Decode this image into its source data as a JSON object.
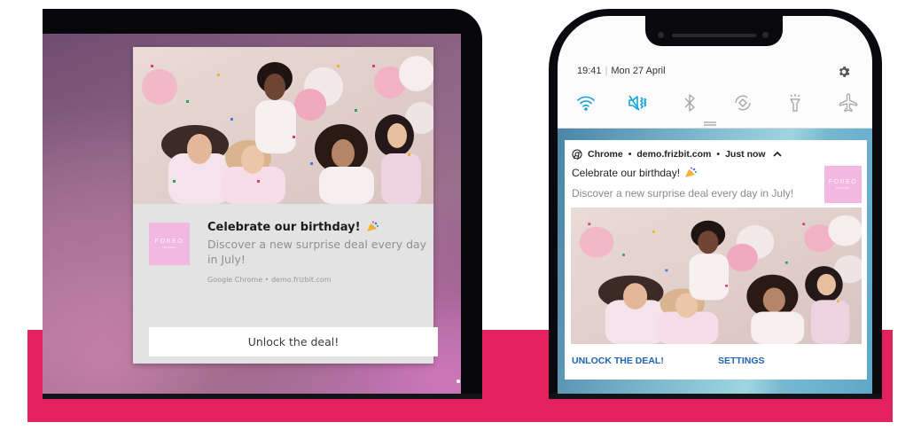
{
  "colors": {
    "band": "#e2215e",
    "brand_tile": "#f2b8e1",
    "mobile_action": "#1e63b5",
    "quick_setting_active": "#1aa3d9",
    "quick_setting_inactive": "#a8a8a8"
  },
  "desktop_notification": {
    "image_alt": "Group of friends celebrating with confetti and pink balloons",
    "logo_text": "FOREO",
    "logo_subtext": "SWEDEN",
    "title": "Celebrate our birthday!",
    "title_emoji": "party-popper-icon",
    "body": "Discover a new surprise deal every day in July!",
    "source": "Google Chrome • demo.frizbit.com",
    "action_label": "Unlock the deal!"
  },
  "phone": {
    "status": {
      "time": "19:41",
      "separator": "|",
      "date": "Mon 27 April",
      "settings_icon": "gear-icon"
    },
    "quick_settings": [
      {
        "name": "wifi",
        "icon": "wifi-icon",
        "active": true
      },
      {
        "name": "sound",
        "icon": "vibrate-mute-icon",
        "active": true
      },
      {
        "name": "bluetooth",
        "icon": "bluetooth-icon",
        "active": false
      },
      {
        "name": "auto-rotate",
        "icon": "rotate-icon",
        "active": false
      },
      {
        "name": "flashlight",
        "icon": "flashlight-icon",
        "active": false
      },
      {
        "name": "airplane",
        "icon": "airplane-icon",
        "active": false
      }
    ],
    "notification": {
      "app": "Chrome",
      "domain": "demo.frizbit.com",
      "time": "Just now",
      "separator": "•",
      "title": "Celebrate our birthday!",
      "body": "Discover a new surprise deal every day in July!",
      "logo_text": "FOREO",
      "logo_subtext": "SWEDEN",
      "image_alt": "Group of friends celebrating with confetti and pink balloons",
      "actions": [
        "UNLOCK THE DEAL!",
        "SETTINGS"
      ]
    }
  }
}
